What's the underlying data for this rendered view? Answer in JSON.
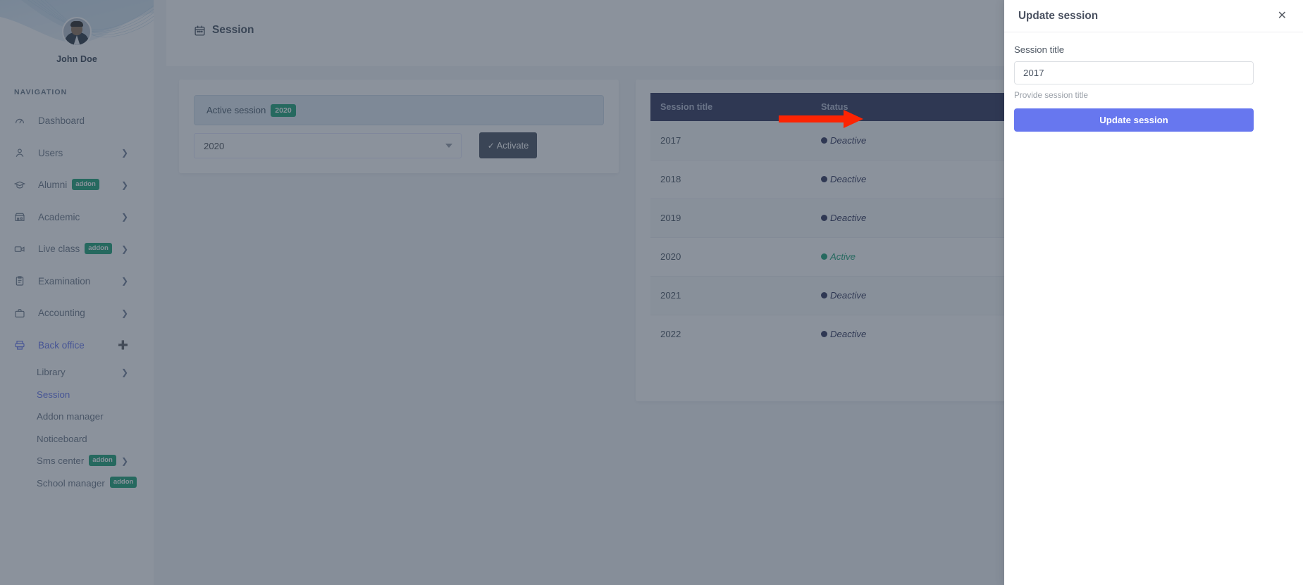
{
  "sidebar": {
    "profile": {
      "name": "John Doe",
      "avatar_icon": "user-avatar"
    },
    "nav_label": "NAVIGATION",
    "items": [
      {
        "label": "Dashboard",
        "icon": "speedometer-icon",
        "badge": null,
        "chevron": false,
        "active": false
      },
      {
        "label": "Users",
        "icon": "user-icon",
        "badge": null,
        "chevron": true,
        "active": false
      },
      {
        "label": "Alumni",
        "icon": "graduation-cap-icon",
        "badge": "addon",
        "chevron": true,
        "active": false
      },
      {
        "label": "Academic",
        "icon": "building-icon",
        "badge": null,
        "chevron": true,
        "active": false
      },
      {
        "label": "Live class",
        "icon": "video-camera-icon",
        "badge": "addon",
        "chevron": true,
        "active": false
      },
      {
        "label": "Examination",
        "icon": "clipboard-icon",
        "badge": null,
        "chevron": true,
        "active": false
      },
      {
        "label": "Accounting",
        "icon": "briefcase-icon",
        "badge": null,
        "chevron": true,
        "active": false
      },
      {
        "label": "Back office",
        "icon": "printer-icon",
        "badge": null,
        "chevron": true,
        "active": true,
        "expanded": true
      }
    ],
    "sub_items": [
      {
        "label": "Library",
        "badge": null,
        "chevron": true,
        "active": false
      },
      {
        "label": "Session",
        "badge": null,
        "chevron": false,
        "active": true
      },
      {
        "label": "Addon manager",
        "badge": null,
        "chevron": false,
        "active": false
      },
      {
        "label": "Noticeboard",
        "badge": null,
        "chevron": false,
        "active": false
      },
      {
        "label": "Sms center",
        "badge": "addon",
        "chevron": true,
        "active": false
      },
      {
        "label": "School manager",
        "badge": "addon",
        "chevron": false,
        "active": false
      }
    ]
  },
  "header": {
    "page_title": "Session",
    "page_icon": "calendar-icon"
  },
  "left_card": {
    "alert_text": "Active session",
    "alert_badge": "2020",
    "select_value": "2020",
    "activate_button": "Activate",
    "activate_icon": "check-icon"
  },
  "table": {
    "columns": [
      "Session title",
      "Status"
    ],
    "rows": [
      {
        "title": "2017",
        "status": "Deactive",
        "state": "deactive"
      },
      {
        "title": "2018",
        "status": "Deactive",
        "state": "deactive"
      },
      {
        "title": "2019",
        "status": "Deactive",
        "state": "deactive"
      },
      {
        "title": "2020",
        "status": "Active",
        "state": "active"
      },
      {
        "title": "2021",
        "status": "Deactive",
        "state": "deactive"
      },
      {
        "title": "2022",
        "status": "Deactive",
        "state": "deactive"
      }
    ]
  },
  "offcanvas": {
    "title": "Update session",
    "close_icon": "close-icon",
    "field_label": "Session title",
    "field_value": "2017",
    "field_placeholder": "Session title",
    "field_help": "Provide session title",
    "submit_label": "Update session"
  },
  "annotation": {
    "arrow_color": "#fc2403",
    "arrow_direction": "right"
  },
  "colors": {
    "accent": "#6777ef",
    "green": "#20a579",
    "table_header": "#34395e",
    "activate_button": "#4c5564",
    "alert_bg": "#e3ebf3"
  }
}
